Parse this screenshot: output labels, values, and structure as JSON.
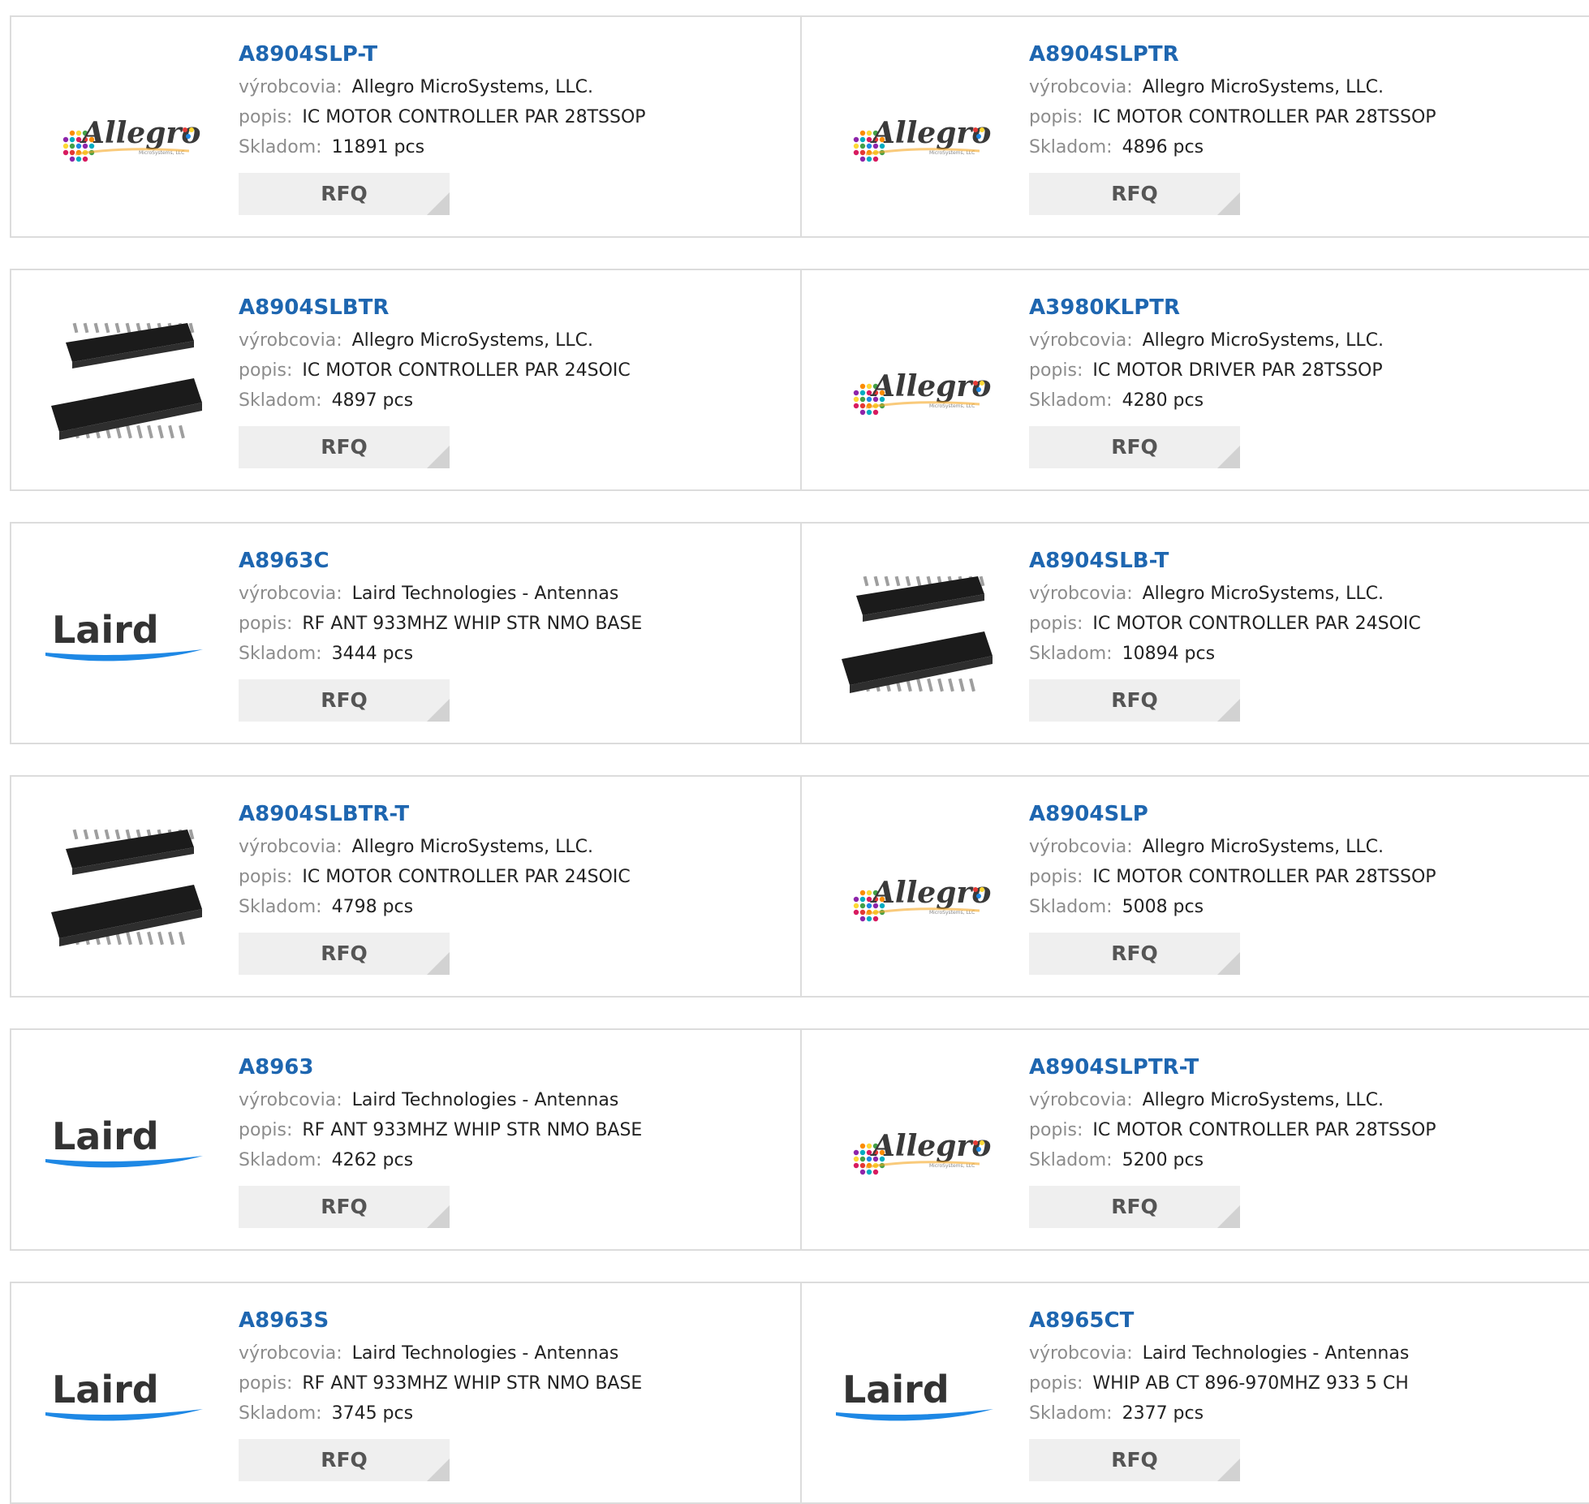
{
  "labels": {
    "manufacturer": "výrobcovia:",
    "description": "popis:",
    "stock": "Skladom:",
    "rfq": "RFQ"
  },
  "logos": {
    "allegro": "Allegro",
    "allegro_sub": "MicroSystems, LLC",
    "laird": "Laird"
  },
  "products": [
    {
      "part": "A8904SLP-T",
      "manufacturer": "Allegro MicroSystems, LLC.",
      "description": "IC MOTOR CONTROLLER PAR 28TSSOP",
      "stock": "11891 pcs",
      "image": "allegro-logo"
    },
    {
      "part": "A8904SLPTR",
      "manufacturer": "Allegro MicroSystems, LLC.",
      "description": "IC MOTOR CONTROLLER PAR 28TSSOP",
      "stock": "4896 pcs",
      "image": "allegro-logo"
    },
    {
      "part": "A8904SLBTR",
      "manufacturer": "Allegro MicroSystems, LLC.",
      "description": "IC MOTOR CONTROLLER PAR 24SOIC",
      "stock": "4897 pcs",
      "image": "soic-chip-photo"
    },
    {
      "part": "A3980KLPTR",
      "manufacturer": "Allegro MicroSystems, LLC.",
      "description": "IC MOTOR DRIVER PAR 28TSSOP",
      "stock": "4280 pcs",
      "image": "allegro-logo"
    },
    {
      "part": "A8963C",
      "manufacturer": "Laird Technologies - Antennas",
      "description": "RF ANT 933MHZ WHIP STR NMO BASE",
      "stock": "3444 pcs",
      "image": "laird-logo"
    },
    {
      "part": "A8904SLB-T",
      "manufacturer": "Allegro MicroSystems, LLC.",
      "description": "IC MOTOR CONTROLLER PAR 24SOIC",
      "stock": "10894 pcs",
      "image": "soic-chip-photo"
    },
    {
      "part": "A8904SLBTR-T",
      "manufacturer": "Allegro MicroSystems, LLC.",
      "description": "IC MOTOR CONTROLLER PAR 24SOIC",
      "stock": "4798 pcs",
      "image": "soic-chip-photo"
    },
    {
      "part": "A8904SLP",
      "manufacturer": "Allegro MicroSystems, LLC.",
      "description": "IC MOTOR CONTROLLER PAR 28TSSOP",
      "stock": "5008 pcs",
      "image": "allegro-logo"
    },
    {
      "part": "A8963",
      "manufacturer": "Laird Technologies - Antennas",
      "description": "RF ANT 933MHZ WHIP STR NMO BASE",
      "stock": "4262 pcs",
      "image": "laird-logo"
    },
    {
      "part": "A8904SLPTR-T",
      "manufacturer": "Allegro MicroSystems, LLC.",
      "description": "IC MOTOR CONTROLLER PAR 28TSSOP",
      "stock": "5200 pcs",
      "image": "allegro-logo"
    },
    {
      "part": "A8963S",
      "manufacturer": "Laird Technologies - Antennas",
      "description": "RF ANT 933MHZ WHIP STR NMO BASE",
      "stock": "3745 pcs",
      "image": "laird-logo"
    },
    {
      "part": "A8965CT",
      "manufacturer": "Laird Technologies - Antennas",
      "description": "WHIP AB CT 896-970MHZ 933 5 CH",
      "stock": "2377 pcs",
      "image": "laird-logo"
    }
  ]
}
